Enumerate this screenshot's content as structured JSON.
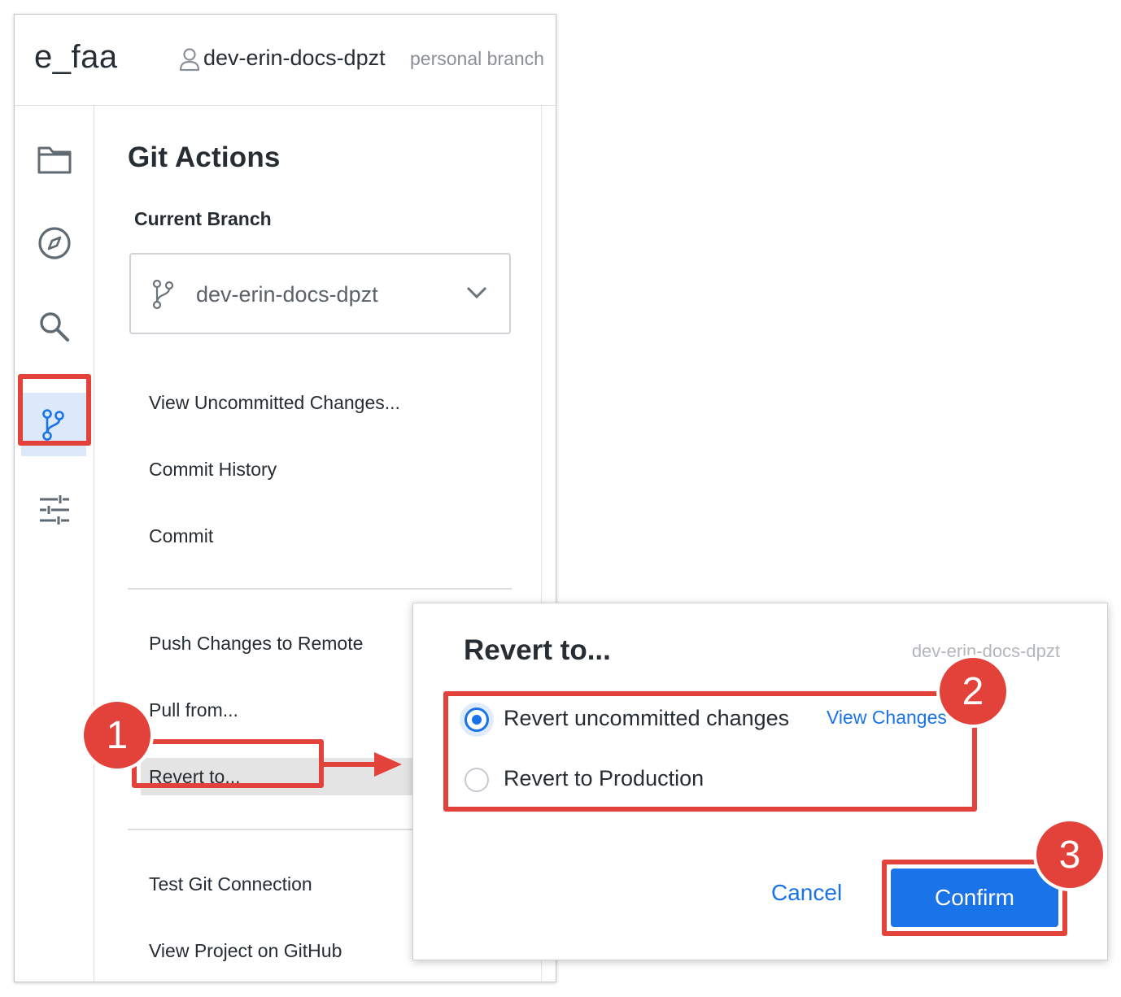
{
  "header": {
    "project_name": "e_faa",
    "branch_name": "dev-erin-docs-dpzt",
    "branch_note": "personal branch"
  },
  "sidebar": {
    "icons": [
      "folder-icon",
      "compass-icon",
      "search-icon",
      "git-branch-icon",
      "settings-sliders-icon"
    ],
    "active": "git-branch-icon"
  },
  "git_panel": {
    "title": "Git Actions",
    "current_branch_label": "Current Branch",
    "current_branch_value": "dev-erin-docs-dpzt",
    "menu": [
      "View Uncommitted Changes...",
      "Commit History",
      "Commit",
      "Push Changes to Remote",
      "Pull from...",
      "Revert to...",
      "Test Git Connection",
      "View Project on GitHub"
    ]
  },
  "dialog": {
    "title": "Revert to...",
    "branch": "dev-erin-docs-dpzt",
    "options": [
      {
        "label": "Revert uncommitted changes",
        "checked": true
      },
      {
        "label": "Revert to Production",
        "checked": false
      }
    ],
    "view_changes_label": "View Changes",
    "cancel_label": "Cancel",
    "confirm_label": "Confirm"
  },
  "annotations": {
    "steps": [
      "1",
      "2",
      "3"
    ]
  },
  "colors": {
    "accent": "#1a73e8",
    "highlight": "#e2423a",
    "active_bg": "#dce9fb"
  }
}
